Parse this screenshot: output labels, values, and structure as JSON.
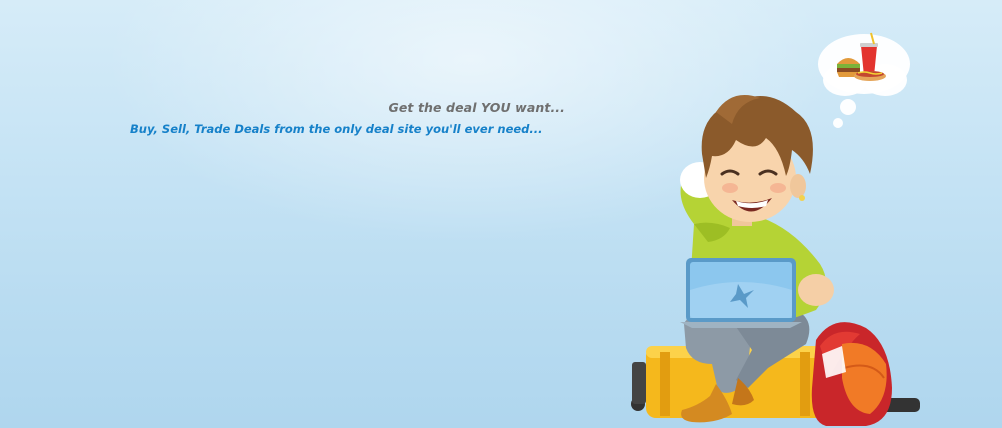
{
  "hero": {
    "tagline": "Get the deal YOU want...",
    "subtagline": "Buy, Sell, Trade Deals from the only deal site you'll ever need..."
  },
  "colors": {
    "tagline": "#6f6f6f",
    "subtagline": "#1681c9",
    "background": "#c7e4f5"
  },
  "icons": {
    "illustration": "boy-with-laptop-illustration",
    "thought": "burger-soda-thought-bubble-icon",
    "suitcase": "suitcase-icon",
    "backpack": "backpack-icon",
    "laptop": "laptop-icon"
  }
}
